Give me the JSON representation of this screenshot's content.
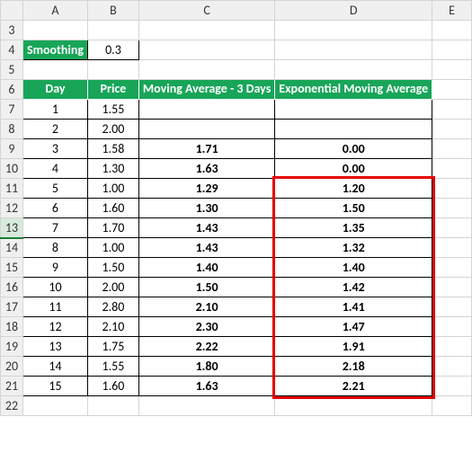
{
  "cols": [
    "A",
    "B",
    "C",
    "D",
    "E"
  ],
  "rows": [
    "3",
    "4",
    "5",
    "6",
    "7",
    "8",
    "9",
    "10",
    "11",
    "12",
    "13",
    "14",
    "15",
    "16",
    "17",
    "18",
    "19",
    "20",
    "21",
    "22"
  ],
  "smoothing": {
    "label": "Smoothing",
    "value": "0.3"
  },
  "headers": {
    "day": "Day",
    "price": "Price",
    "ma3": "Moving Average - 3 Days",
    "ema": "Exponential Moving Average"
  },
  "selected_row": "13",
  "chart_data": {
    "type": "table",
    "columns": [
      "Day",
      "Price",
      "Moving Average - 3 Days",
      "Exponential Moving Average"
    ],
    "rows": [
      {
        "day": "1",
        "price": "1.55",
        "ma3": "",
        "ema": ""
      },
      {
        "day": "2",
        "price": "2.00",
        "ma3": "",
        "ema": ""
      },
      {
        "day": "3",
        "price": "1.58",
        "ma3": "1.71",
        "ema": "0.00"
      },
      {
        "day": "4",
        "price": "1.30",
        "ma3": "1.63",
        "ema": "0.00"
      },
      {
        "day": "5",
        "price": "1.00",
        "ma3": "1.29",
        "ema": "1.20"
      },
      {
        "day": "6",
        "price": "1.60",
        "ma3": "1.30",
        "ema": "1.50"
      },
      {
        "day": "7",
        "price": "1.70",
        "ma3": "1.43",
        "ema": "1.35"
      },
      {
        "day": "8",
        "price": "1.00",
        "ma3": "1.43",
        "ema": "1.32"
      },
      {
        "day": "9",
        "price": "1.50",
        "ma3": "1.40",
        "ema": "1.40"
      },
      {
        "day": "10",
        "price": "2.00",
        "ma3": "1.50",
        "ema": "1.42"
      },
      {
        "day": "11",
        "price": "2.80",
        "ma3": "2.10",
        "ema": "1.41"
      },
      {
        "day": "12",
        "price": "2.10",
        "ma3": "2.30",
        "ema": "1.47"
      },
      {
        "day": "13",
        "price": "1.75",
        "ma3": "2.22",
        "ema": "1.91"
      },
      {
        "day": "14",
        "price": "1.55",
        "ma3": "1.80",
        "ema": "2.18"
      },
      {
        "day": "15",
        "price": "1.60",
        "ma3": "1.63",
        "ema": "2.21"
      }
    ]
  }
}
